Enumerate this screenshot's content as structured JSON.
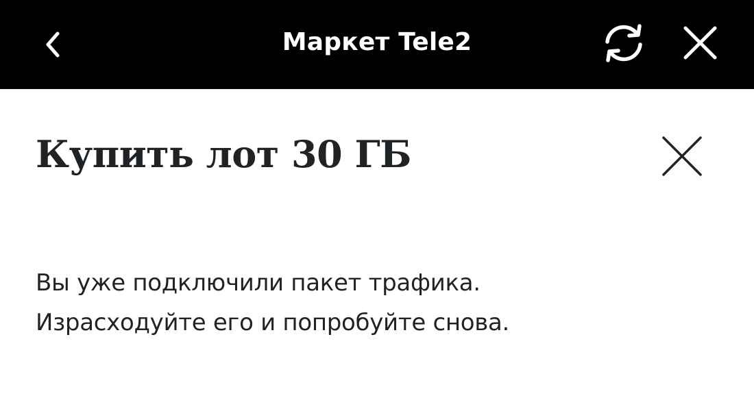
{
  "header": {
    "title": "Маркет Tele2",
    "back_icon": "chevron-left-icon",
    "refresh_icon": "refresh-icon",
    "close_icon": "close-icon",
    "background_color": "#000000",
    "text_color": "#ffffff"
  },
  "dialog": {
    "title": "Купить лот 30 ГБ",
    "close_icon": "close-icon",
    "message_lines": [
      "Вы уже подключили пакет трафика.",
      "Израсходуйте его и попробуйте снова."
    ],
    "text_color": "#1f2326"
  }
}
